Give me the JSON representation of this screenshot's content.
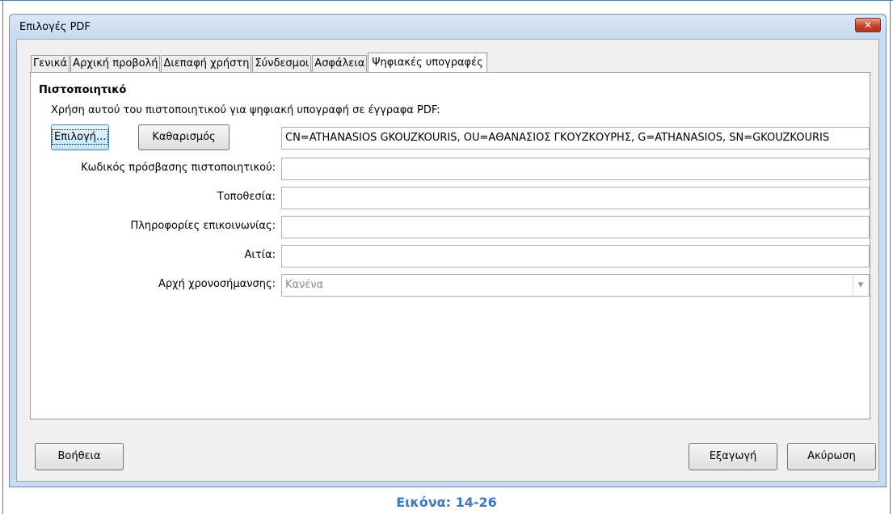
{
  "window": {
    "title": "Επιλογές PDF",
    "close_icon": "close-icon"
  },
  "tabs": [
    {
      "label": "Γενικά",
      "active": false
    },
    {
      "label": "Αρχική προβολή",
      "active": false
    },
    {
      "label": "Διεπαφή χρήστη",
      "active": false
    },
    {
      "label": "Σύνδεσμοι",
      "active": false
    },
    {
      "label": "Ασφάλεια",
      "active": false
    },
    {
      "label": "Ψηφιακές υπογραφές",
      "active": true
    }
  ],
  "certificate": {
    "section_title": "Πιστοποιητικό",
    "usage_text": "Χρήση αυτού του πιστοποιητικού για ψηφιακή υπογραφή σε έγγραφα PDF:",
    "select_button": "Επιλογή...",
    "clear_button": "Καθαρισμός",
    "certificate_value": "CN=ATHANASIOS GKOUZKOURIS, OU=ΑΘΑΝΑΣΙΟΣ ΓΚΟΥΖΚΟΥΡΗΣ, G=ATHANASIOS, SN=GKOUZKOURIS"
  },
  "fields": {
    "password_label": "Κωδικός πρόσβασης πιστοποιητικού:",
    "password_value": "",
    "location_label": "Τοποθεσία:",
    "location_value": "",
    "contact_label": "Πληροφορίες επικοινωνίας:",
    "contact_value": "",
    "reason_label": "Αιτία:",
    "reason_value": "",
    "timestamp_label": "Αρχή χρονοσήμανσης:",
    "timestamp_value": "Κανένα"
  },
  "footer": {
    "help_button": "Βοήθεια",
    "export_button": "Εξαγωγή",
    "cancel_button": "Ακύρωση"
  },
  "caption": "Εικόνα: 14-26"
}
